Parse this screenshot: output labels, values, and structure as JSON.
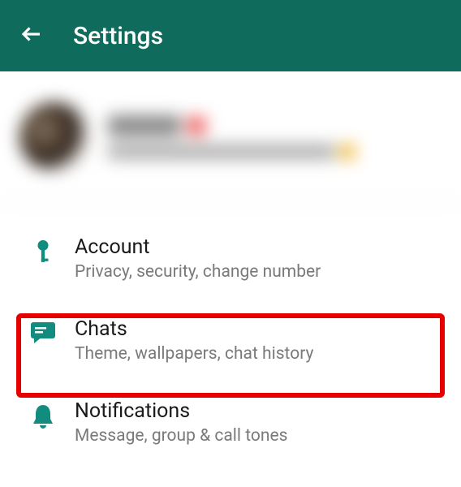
{
  "header": {
    "title": "Settings"
  },
  "settings": {
    "items": [
      {
        "title": "Account",
        "subtitle": "Privacy, security, change number"
      },
      {
        "title": "Chats",
        "subtitle": "Theme, wallpapers, chat history"
      },
      {
        "title": "Notifications",
        "subtitle": "Message, group & call tones"
      }
    ]
  },
  "colors": {
    "header": "#0f6b5c",
    "accent": "#128c7e",
    "highlight": "#e60000"
  }
}
